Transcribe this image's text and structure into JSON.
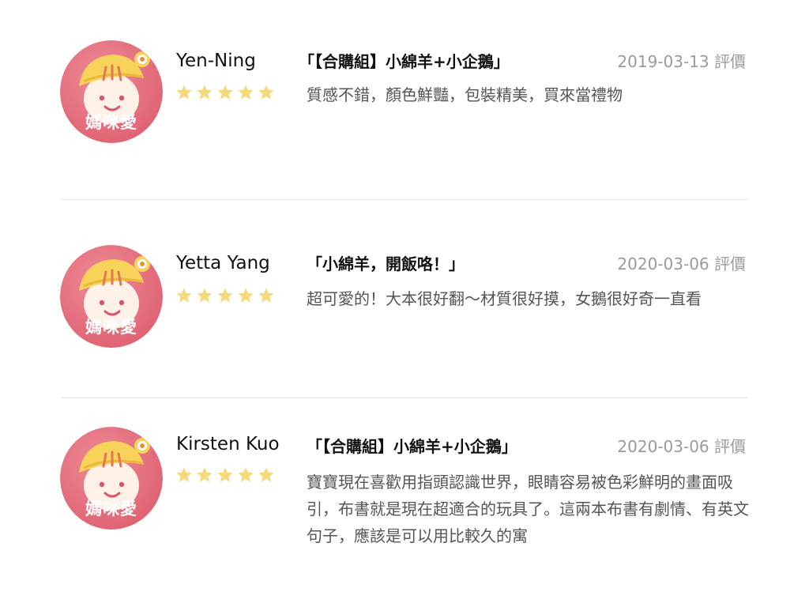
{
  "reviews": [
    {
      "avatar_icon": "mamiai-logo-icon",
      "avatar_text": "媽咪愛",
      "name": "Yen-Ning",
      "rating": 5,
      "title": "「【合購組】小綿羊+小企鵝」",
      "date": "2019-03-13 評價",
      "body": "質感不錯，顏色鮮豔，包裝精美，買來當禮物"
    },
    {
      "avatar_icon": "mamiai-logo-icon",
      "avatar_text": "媽咪愛",
      "name": "Yetta Yang",
      "rating": 5,
      "title": "「小綿羊，開飯咯！」",
      "date": "2020-03-06 評價",
      "body": "超可愛的！大本很好翻～材質很好摸，女鵝很好奇一直看"
    },
    {
      "avatar_icon": "mamiai-logo-icon",
      "avatar_text": "媽咪愛",
      "name": "Kirsten Kuo",
      "rating": 5,
      "title": "「【合購組】小綿羊+小企鵝」",
      "date": "2020-03-06 評價",
      "body": "寶寶現在喜歡用指頭認識世界，眼睛容易被色彩鮮明的畫面吸引，布書就是現在超適合的玩具了。這兩本布書有劇情、有英文句子，應該是可以用比較久的寓"
    }
  ],
  "colors": {
    "avatar_bg": "#e8727f",
    "avatar_face": "#fdf1e8",
    "hat": "#f8d35a",
    "star": "#f5d97b",
    "divider": "#e3e3e3",
    "date": "#9b9b9b"
  }
}
